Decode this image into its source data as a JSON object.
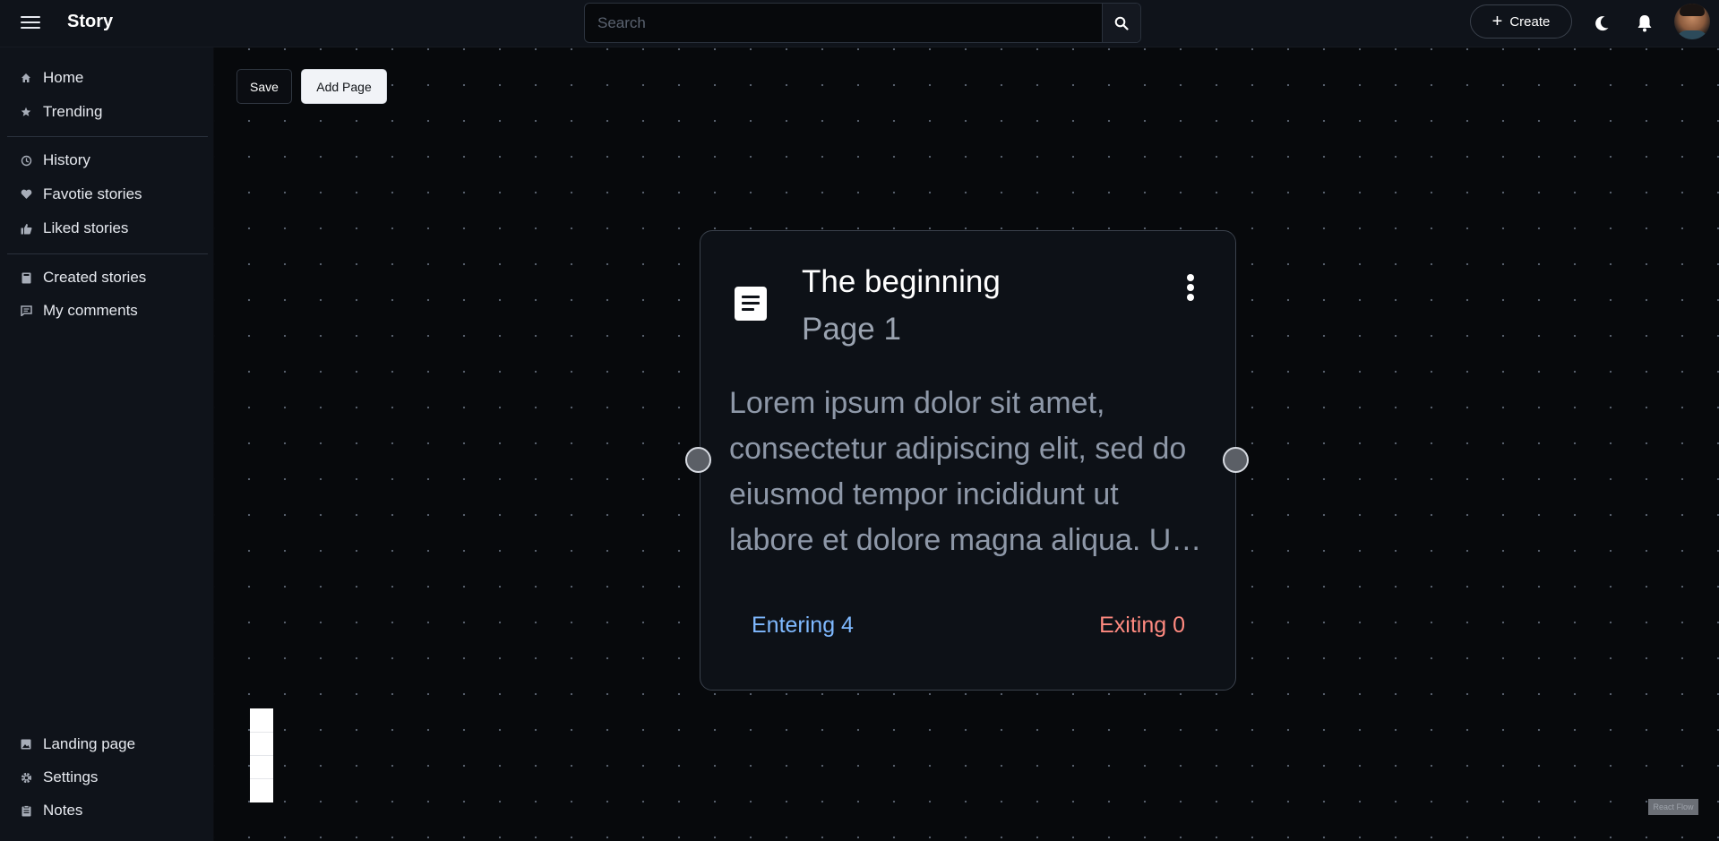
{
  "header": {
    "brand": "Story",
    "search_placeholder": "Search",
    "create_label": "Create"
  },
  "sidebar": {
    "items": [
      {
        "label": "Home",
        "icon": "home-icon"
      },
      {
        "label": "Trending",
        "icon": "star-icon"
      },
      {
        "label": "History",
        "icon": "history-icon"
      },
      {
        "label": "Favotie stories",
        "icon": "heart-icon"
      },
      {
        "label": "Liked stories",
        "icon": "thumbs-up-icon"
      },
      {
        "label": "Created stories",
        "icon": "book-icon"
      },
      {
        "label": "My comments",
        "icon": "comment-icon"
      }
    ],
    "bottom_items": [
      {
        "label": "Landing page",
        "icon": "image-icon"
      },
      {
        "label": "Settings",
        "icon": "gear-icon"
      },
      {
        "label": "Notes",
        "icon": "clipboard-icon"
      }
    ]
  },
  "toolbar": {
    "save_label": "Save",
    "add_page_label": "Add Page"
  },
  "node": {
    "title": "The beginning",
    "subtitle": "Page 1",
    "body": "Lorem ipsum dolor sit amet, consectetur adipiscing elit, sed do eiusmod tempor incididunt ut labore et dolore magna aliqua. Ut enim ad minim veniam",
    "entering": "Entering 4",
    "exiting": "Exiting 0"
  },
  "attribution": "React Flow",
  "colors": {
    "background": "#07090c",
    "panel": "#0f131a",
    "entering": "#7fb9ff",
    "exiting": "#ff8a80"
  }
}
